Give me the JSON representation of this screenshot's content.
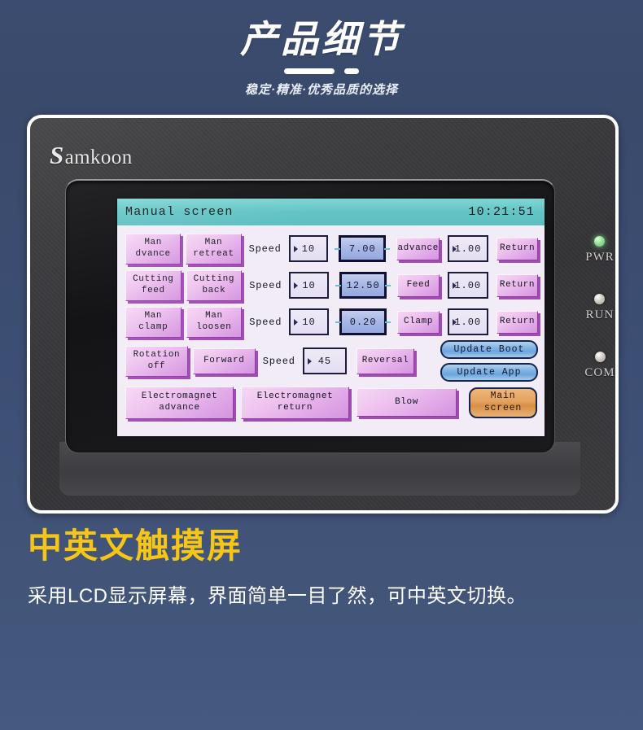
{
  "header": {
    "title": "产品细节",
    "subtitle": "稳定·精准·优秀品质的选择"
  },
  "device": {
    "brand_initial": "S",
    "brand_rest": "amkoon",
    "leds": [
      {
        "label": "PWR",
        "state": "on",
        "color": "#7fe08a"
      },
      {
        "label": "RUN",
        "state": "off",
        "color": "#cfcac4"
      },
      {
        "label": "COM",
        "state": "off",
        "color": "#cfcac4"
      }
    ]
  },
  "hmi": {
    "titlebar": {
      "screen_name": "Manual screen",
      "clock": "10:21:51",
      "bg_color": "#63c4c5"
    },
    "rows": [
      {
        "btn_left": "Man\ndvance",
        "btn_left_l1": "Man",
        "btn_left_l2": "dvance",
        "btn_right_l1": "Man",
        "btn_right_l2": "retreat",
        "speed_label": "Speed",
        "speed_value": "10",
        "highlight_value": "7.00",
        "mid_button": "advance",
        "time_value": "1.00",
        "return_button": "Return"
      },
      {
        "btn_left_l1": "Cutting",
        "btn_left_l2": "feed",
        "btn_right_l1": "Cutting",
        "btn_right_l2": "back",
        "speed_label": "Speed",
        "speed_value": "10",
        "highlight_value": "12.50",
        "mid_button": "Feed",
        "time_value": "1.00",
        "return_button": "Return"
      },
      {
        "btn_left_l1": "Man",
        "btn_left_l2": "clamp",
        "btn_right_l1": "Man",
        "btn_right_l2": "loosen",
        "speed_label": "Speed",
        "speed_value": "10",
        "highlight_value": "0.20",
        "mid_button": "Clamp",
        "time_value": "1.00",
        "return_button": "Return"
      }
    ],
    "rotation_row": {
      "btn_rotation_l1": "Rotation",
      "btn_rotation_l2": "off",
      "btn_forward": "Forward",
      "speed_label": "Speed",
      "speed_value": "45",
      "btn_reversal": "Reversal",
      "update_boot": "Update Boot",
      "update_app": "Update App"
    },
    "bottom_row": {
      "electromagnet_advance_l1": "Electromagnet",
      "electromagnet_advance_l2": "advance",
      "electromagnet_return_l1": "Electromagnet",
      "electromagnet_return_l2": "return",
      "blow": "Blow",
      "main_screen_l1": "Main",
      "main_screen_l2": "screen",
      "main_screen_color": "#e3a260"
    }
  },
  "caption": {
    "heading": "中英文触摸屏",
    "body": "采用LCD显示屏幕，界面简单一目了然，可中英文切换。"
  }
}
